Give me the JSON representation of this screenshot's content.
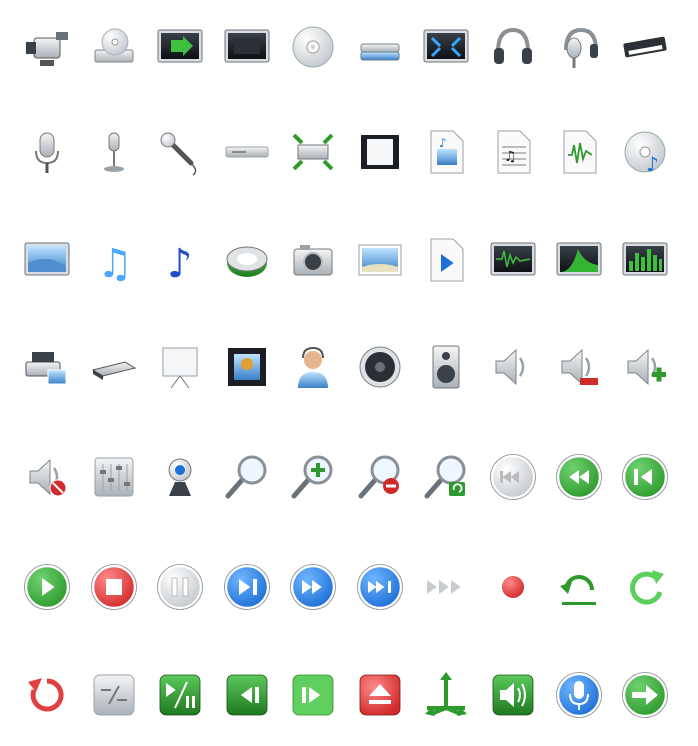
{
  "icon_set": {
    "rows": [
      [
        "camcorder-icon",
        "dvd-drive-icon",
        "tv-play-icon",
        "monitor-icon",
        "cd-disc-icon",
        "scanner-stack-icon",
        "fullscreen-expand-icon",
        "headphones-icon",
        "headset-mic-icon",
        "keyboard-synth-icon"
      ],
      [
        "studio-microphone-icon",
        "desk-microphone-icon",
        "handheld-microphone-icon",
        "cd-player-deck-icon",
        "fit-screen-icon",
        "film-strip-icon",
        "music-video-file-icon",
        "sheet-music-file-icon",
        "audio-wave-file-icon",
        "music-disc-icon"
      ],
      [
        "widescreen-display-icon",
        "music-note-blue-icon",
        "music-note-dark-blue-icon",
        "media-sync-icon",
        "photo-camera-icon",
        "landscape-picture-icon",
        "video-file-icon",
        "waveform-monitor-icon",
        "spectrum-monitor-icon",
        "equalizer-monitor-icon"
      ],
      [
        "photo-printer-icon",
        "flatbed-scanner-icon",
        "projection-screen-icon",
        "film-frame-icon",
        "user-headset-icon",
        "speaker-cone-icon",
        "speaker-box-icon",
        "volume-icon",
        "volume-down-icon",
        "volume-up-icon"
      ],
      [
        "mute-speaker-icon",
        "mixer-sliders-icon",
        "webcam-icon",
        "zoom-icon",
        "zoom-in-icon",
        "zoom-out-icon",
        "zoom-reset-icon",
        "skip-back-disabled-icon",
        "rewind-icon",
        "previous-track-icon"
      ],
      [
        "play-icon",
        "stop-icon",
        "pause-icon",
        "next-track-icon",
        "fast-forward-icon",
        "skip-forward-icon",
        "forward-arrows-icon",
        "record-icon",
        "undo-icon",
        "refresh-icon"
      ],
      [
        "rotate-left-icon",
        "split-view-icon",
        "play-pause-icon",
        "step-back-icon",
        "step-forward-icon",
        "eject-icon",
        "move-arrows-icon",
        "sound-volume-icon",
        "voice-mic-icon",
        "next-arrow-icon"
      ]
    ]
  },
  "colors": {
    "green": "#2e9a2e",
    "green_light": "#6fd16f",
    "blue": "#1e6fd6",
    "blue_light": "#6fb6ff",
    "red": "#d12a2a",
    "gray": "#9aa1a8",
    "gray_light": "#e6e8ea",
    "dark": "#2a2f36"
  }
}
